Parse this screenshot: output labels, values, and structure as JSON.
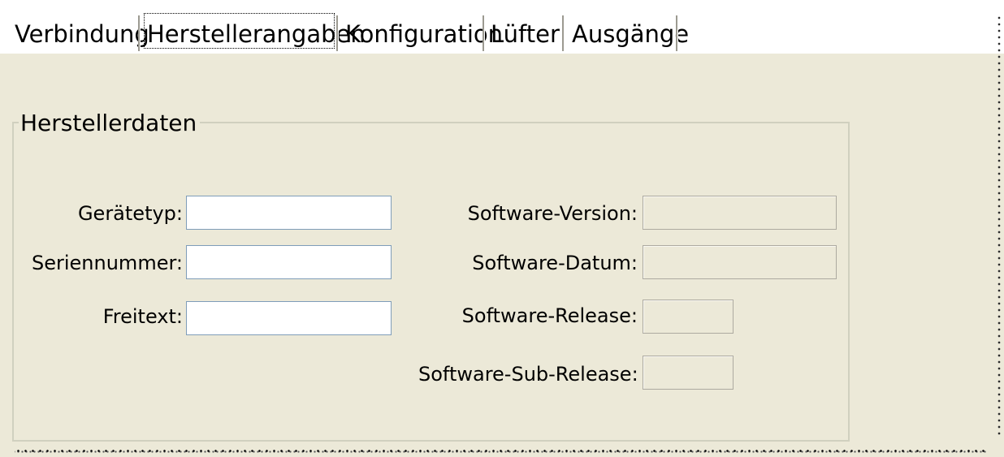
{
  "tabs": [
    {
      "label": "Verbindung"
    },
    {
      "label": "Herstellerangaben"
    },
    {
      "label": "Konfiguration"
    },
    {
      "label": "Lüfter"
    },
    {
      "label": "Ausgänge"
    }
  ],
  "active_tab": "Herstellerangaben",
  "groupbox": {
    "title": "Herstellerdaten"
  },
  "left_fields": {
    "geraetetyp": {
      "label": "Gerätetyp:",
      "value": ""
    },
    "seriennummer": {
      "label": "Seriennummer:",
      "value": ""
    },
    "freitext": {
      "label": "Freitext:",
      "value": ""
    }
  },
  "right_fields": {
    "software_version": {
      "label": "Software-Version:",
      "value": ""
    },
    "software_datum": {
      "label": "Software-Datum:",
      "value": ""
    },
    "software_release": {
      "label": "Software-Release:",
      "value": ""
    },
    "software_sub_release": {
      "label": "Software-Sub-Release:",
      "value": ""
    }
  },
  "colors": {
    "window_background": "#ece9d8",
    "tab_background": "#ffffff",
    "field_border": "#7f9db9",
    "group_border": "#d0d0bf"
  }
}
